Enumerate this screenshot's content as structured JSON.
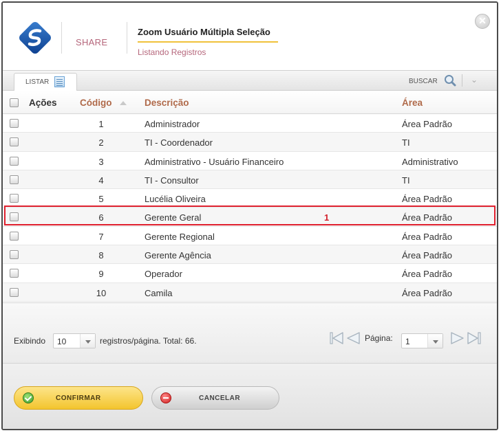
{
  "header": {
    "brand": "SHARE",
    "title": "Zoom Usuário Múltipla Seleção",
    "subtitle": "Listando Registros",
    "close_glyph": "✕"
  },
  "toolbar": {
    "tab_label": "LISTAR",
    "tab_icon": "list-icon",
    "search_label": "BUSCAR",
    "search_icon": "search-icon",
    "expand_icon": "chevron-down-icon",
    "expand_glyph": "⌄"
  },
  "table": {
    "headers": {
      "acoes": "Ações",
      "codigo": "Código",
      "descricao": "Descrição",
      "area": "Área"
    },
    "rows": [
      {
        "codigo": "1",
        "descricao": "Administrador",
        "area": "Área Padrão"
      },
      {
        "codigo": "2",
        "descricao": "TI - Coordenador",
        "area": "TI"
      },
      {
        "codigo": "3",
        "descricao": "Administrativo - Usuário Financeiro",
        "area": "Administrativo"
      },
      {
        "codigo": "4",
        "descricao": "TI - Consultor",
        "area": "TI"
      },
      {
        "codigo": "5",
        "descricao": "Lucélia Oliveira",
        "area": "Área Padrão"
      },
      {
        "codigo": "6",
        "descricao": "Gerente Geral",
        "area": "Área Padrão"
      },
      {
        "codigo": "7",
        "descricao": "Gerente Regional",
        "area": "Área Padrão"
      },
      {
        "codigo": "8",
        "descricao": "Gerente Agência",
        "area": "Área Padrão"
      },
      {
        "codigo": "9",
        "descricao": "Operador",
        "area": "Área Padrão"
      },
      {
        "codigo": "10",
        "descricao": "Camila",
        "area": "Área Padrão"
      }
    ],
    "annotation_marker": "1"
  },
  "pager": {
    "showing_label": "Exibindo",
    "per_page_value": "10",
    "total_label": "registros/página. Total: 66.",
    "page_label": "Página:",
    "page_value": "1"
  },
  "footer": {
    "confirm_label": "CONFIRMAR",
    "cancel_label": "CANCELAR"
  },
  "colors": {
    "accent_gold": "#f3c52e",
    "header_text": "#b06a4a",
    "brand_text": "#b5667b",
    "highlight_red": "#e0202e"
  }
}
